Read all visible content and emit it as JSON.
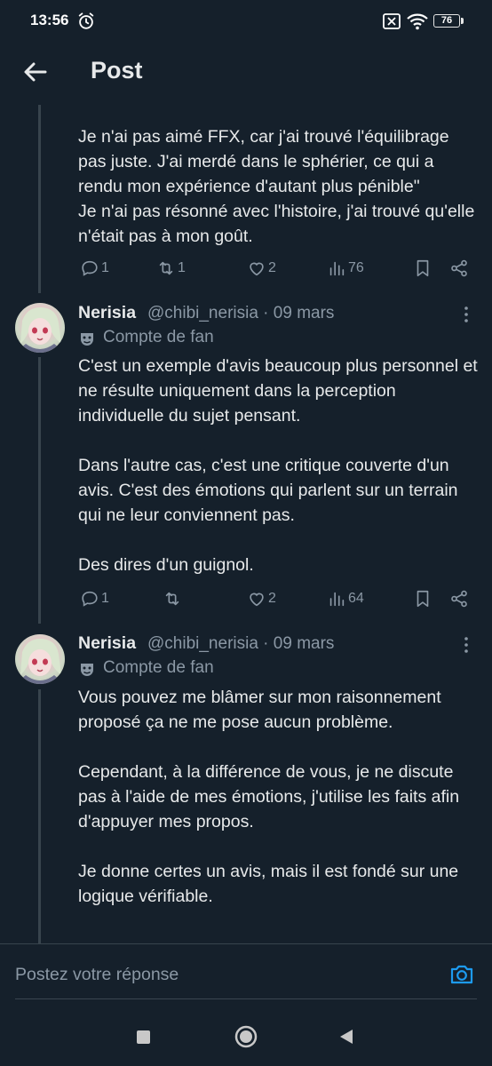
{
  "status": {
    "time": "13:56",
    "battery": "76",
    "icons": [
      "alarm-icon",
      "no-sim-icon",
      "wifi-icon",
      "battery-icon"
    ]
  },
  "header": {
    "title": "Post",
    "back_icon": "arrow-left-icon"
  },
  "tweets": [
    {
      "text": "Je n'ai pas aimé FFX, car j'ai trouvé l'équilibrage pas juste. J'ai merdé dans le sphérier, ce qui a rendu mon expérience d'autant plus pénible\"\nJe n'ai pas résonné avec l'histoire, j'ai trouvé qu'elle n'était pas à mon goût.",
      "replies": "1",
      "retweets": "1",
      "likes": "2",
      "views": "76"
    },
    {
      "author": "Nerisia",
      "handle": "@chibi_nerisia · 09 mars",
      "badge": "Compte de fan",
      "text": "C'est un exemple d'avis beaucoup plus personnel et ne résulte uniquement dans la perception individuelle du sujet pensant.\n\nDans l'autre cas, c'est une critique couverte d'un avis. C'est des émotions qui parlent sur un terrain qui ne leur conviennent pas.\n\nDes dires d'un guignol.",
      "replies": "1",
      "retweets": "",
      "likes": "2",
      "views": "64"
    },
    {
      "author": "Nerisia",
      "handle": "@chibi_nerisia · 09 mars",
      "badge": "Compte de fan",
      "text": "Vous pouvez me blâmer sur mon raisonnement proposé ça ne me pose aucun problème.\n\nCependant, à la différence de vous, je ne discute pas à l'aide de mes émotions, j'utilise les faits afin d'appuyer mes propos.\n\nJe donne certes un avis, mais il est fondé sur une logique vérifiable."
    }
  ],
  "reply": {
    "placeholder": "Postez votre réponse"
  },
  "colors": {
    "background": "#15202b",
    "text": "#e7e9ea",
    "muted": "#8b98a5",
    "accent": "#1d9bf0",
    "thread_line": "#38444d"
  }
}
